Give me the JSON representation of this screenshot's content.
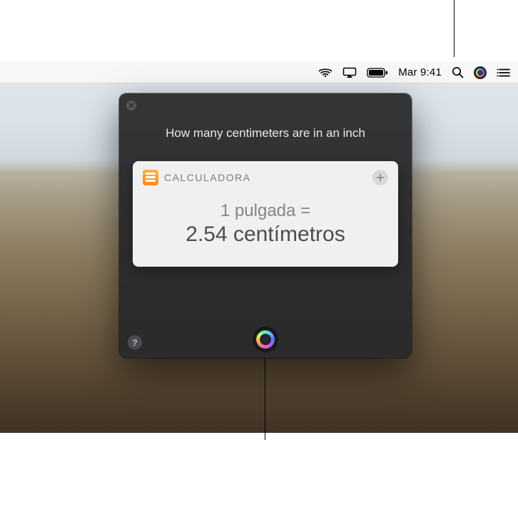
{
  "menubar": {
    "clock": "Mar 9:41",
    "icons": {
      "wifi": "wifi-icon",
      "airplay": "airplay-icon",
      "battery": "battery-icon",
      "search": "search-icon",
      "siri": "siri-icon",
      "notifications": "list-icon"
    }
  },
  "siri": {
    "query": "How many centimeters are in an inch",
    "result": {
      "source_label": "CALCULADORA",
      "line1": "1 pulgada =",
      "line2": "2.54 centímetros"
    },
    "help_label": "?"
  }
}
